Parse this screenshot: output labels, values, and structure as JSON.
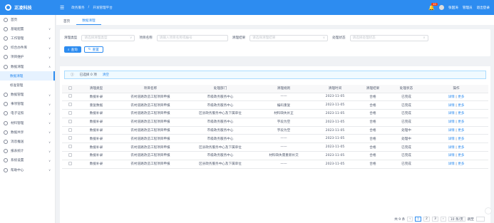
{
  "header": {
    "logo_text": "正凌科技",
    "breadcrumbs": [
      "政务服务",
      "/",
      "开发管理平台"
    ],
    "notify_count": "10",
    "user_name": "张国涛",
    "links": [
      "管理员",
      "退出登录"
    ]
  },
  "sidebar": {
    "items": [
      {
        "label": "首页",
        "type": "top",
        "arrow": ""
      },
      {
        "label": "基础配置",
        "type": "top",
        "arrow": "∨"
      },
      {
        "label": "工作管理",
        "type": "top",
        "arrow": "∨"
      },
      {
        "label": "综合办件库",
        "type": "top",
        "arrow": "∨"
      },
      {
        "label": "项目维护",
        "type": "top",
        "arrow": "∨"
      },
      {
        "label": "数据清理",
        "type": "top",
        "arrow": "∧"
      },
      {
        "label": "数据清理",
        "type": "sub-active",
        "arrow": ""
      },
      {
        "label": "标准管理",
        "type": "sub",
        "arrow": ""
      },
      {
        "label": "数据管理",
        "type": "top",
        "arrow": "∨"
      },
      {
        "label": "事项管理",
        "type": "top",
        "arrow": "∨"
      },
      {
        "label": "电子证照",
        "type": "top",
        "arrow": "∨"
      },
      {
        "label": "材料管理",
        "type": "top",
        "arrow": "∨"
      },
      {
        "label": "数据共享",
        "type": "top",
        "arrow": "∨"
      },
      {
        "label": "消息推送",
        "type": "top",
        "arrow": "∨"
      },
      {
        "label": "报表统计",
        "type": "top",
        "arrow": "∨"
      },
      {
        "label": "系统设置",
        "type": "top",
        "arrow": "∨"
      },
      {
        "label": "帮助中心",
        "type": "top",
        "arrow": "∨"
      }
    ]
  },
  "tabs": [
    {
      "label": "首页",
      "active": false
    },
    {
      "label": "数据清理",
      "active": true
    }
  ],
  "filters": [
    {
      "label": "清理类型",
      "placeholder": "请选择清理类型"
    },
    {
      "label": "项目名称",
      "placeholder": "请输入项目名称或编号"
    },
    {
      "label": "清理结果",
      "placeholder": "请选择清理结果"
    },
    {
      "label": "处理状态",
      "placeholder": "请选择处理状态"
    }
  ],
  "buttons": {
    "search": "查询",
    "reset": "重置"
  },
  "alert": {
    "text": "已选择 0 项",
    "link": "清空"
  },
  "table": {
    "columns": [
      "",
      "清理类型",
      "项目名称",
      "处理部门",
      "清理规则",
      "清理时间",
      "清理结果",
      "处理状态",
      "操作"
    ],
    "rows": [
      [
        "数据补录",
        "农村道路改造工程项目申报",
        "市级政务服务中心",
        "——",
        "2023-11-05",
        "合格",
        "已完成"
      ],
      [
        "重复数据",
        "农村道路改造工程项目申报",
        "市级政务服务中心",
        "编码重复",
        "2023-11-05",
        "合格",
        "已完成"
      ],
      [
        "数据补录",
        "农村道路改造工程项目申报",
        "区县政务服务中心及下属单位",
        "材料缺失补正",
        "2023-11-05",
        "合格",
        "已完成"
      ],
      [
        "数据补录",
        "农村道路改造工程项目申报",
        "市级政务服务中心",
        "字段为空",
        "2023-11-05",
        "合格",
        "已完成"
      ],
      [
        "数据补录",
        "农村道路改造工程项目申报",
        "市级政务服务中心",
        "字段为空",
        "2023-11-05",
        "合格",
        "处理中"
      ],
      [
        "数据补录",
        "农村道路改造工程项目申报",
        "市级政务服务中心",
        "——",
        "2023-11-05",
        "合格",
        "处理中"
      ],
      [
        "数据补录",
        "农村道路改造工程项目申报",
        "区县政务服务中心及下属单位",
        "——",
        "2023-11-05",
        "合格",
        "已完成"
      ],
      [
        "数据补录",
        "农村道路改造工程项目申报",
        "市级政务服务中心",
        "材料缺失需重新补交",
        "2023-11-05",
        "合格",
        "已完成"
      ],
      [
        "数据补录",
        "农村道路改造工程项目申报",
        "区县政务服务中心及下属单位",
        "——",
        "2023-11-05",
        "合格",
        "已完成"
      ]
    ],
    "op_detail": "详情",
    "op_more": "更多"
  },
  "pager": {
    "total": "共 9 条",
    "pages": [
      "1",
      "2",
      "3"
    ],
    "size": "10 条/页",
    "goto": "跳至"
  },
  "colors": {
    "primary": "#2d8cf0",
    "sidebar_active_bg": "#e6f2ff"
  }
}
